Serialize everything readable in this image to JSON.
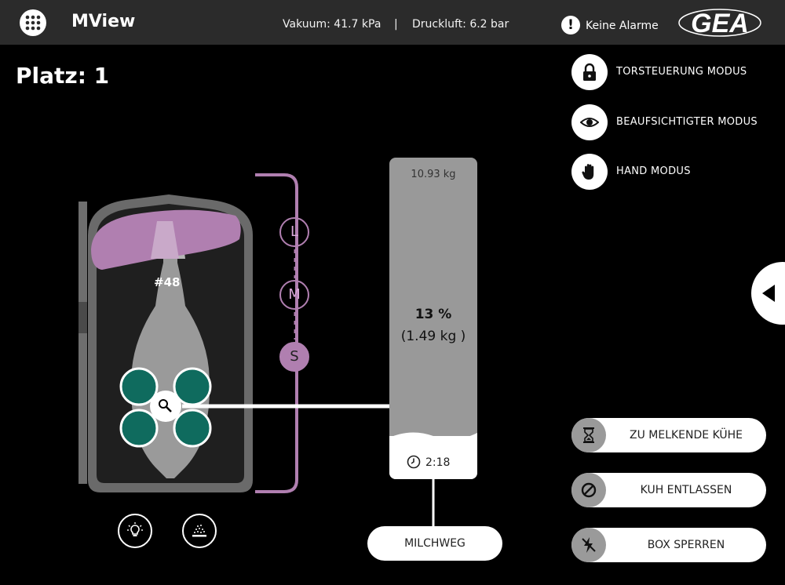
{
  "header": {
    "app_title": "MView",
    "vacuum": "Vakuum: 41.7 kPa",
    "separator": "|",
    "air": "Druckluft: 6.2 bar",
    "alarm_text": "Keine Alarme",
    "logo_text": "GEA"
  },
  "place": "Platz: 1",
  "modes": [
    {
      "label": "TORSTEUERUNG  MODUS",
      "icon": "lock-icon"
    },
    {
      "label": "BEAUFSICHTIGTER  MODUS",
      "icon": "eye-icon"
    },
    {
      "label": "HAND  MODUS",
      "icon": "hand-icon"
    }
  ],
  "actions": [
    {
      "label": "ZU MELKENDE KÜHE",
      "icon": "hourglass-icon"
    },
    {
      "label": "KUH ENTLASSEN",
      "icon": "block-icon"
    },
    {
      "label": "BOX SPERREN",
      "icon": "lightning-off-icon"
    }
  ],
  "milk_button": "MILCHWEG",
  "meter": {
    "max": "10.93 kg",
    "percent": "13 %",
    "amount": "(1.49 kg )",
    "time": "2:18",
    "fill_fraction": 0.13
  },
  "cow": {
    "id": "#48",
    "sizes": [
      "L",
      "M",
      "S"
    ],
    "selected_size": "S"
  },
  "colors": {
    "topbar": "#2b2b2b",
    "teat_cup": "#0f6b5e",
    "accent_purple": "#b07fb0",
    "stall": "#1f1f1f"
  }
}
